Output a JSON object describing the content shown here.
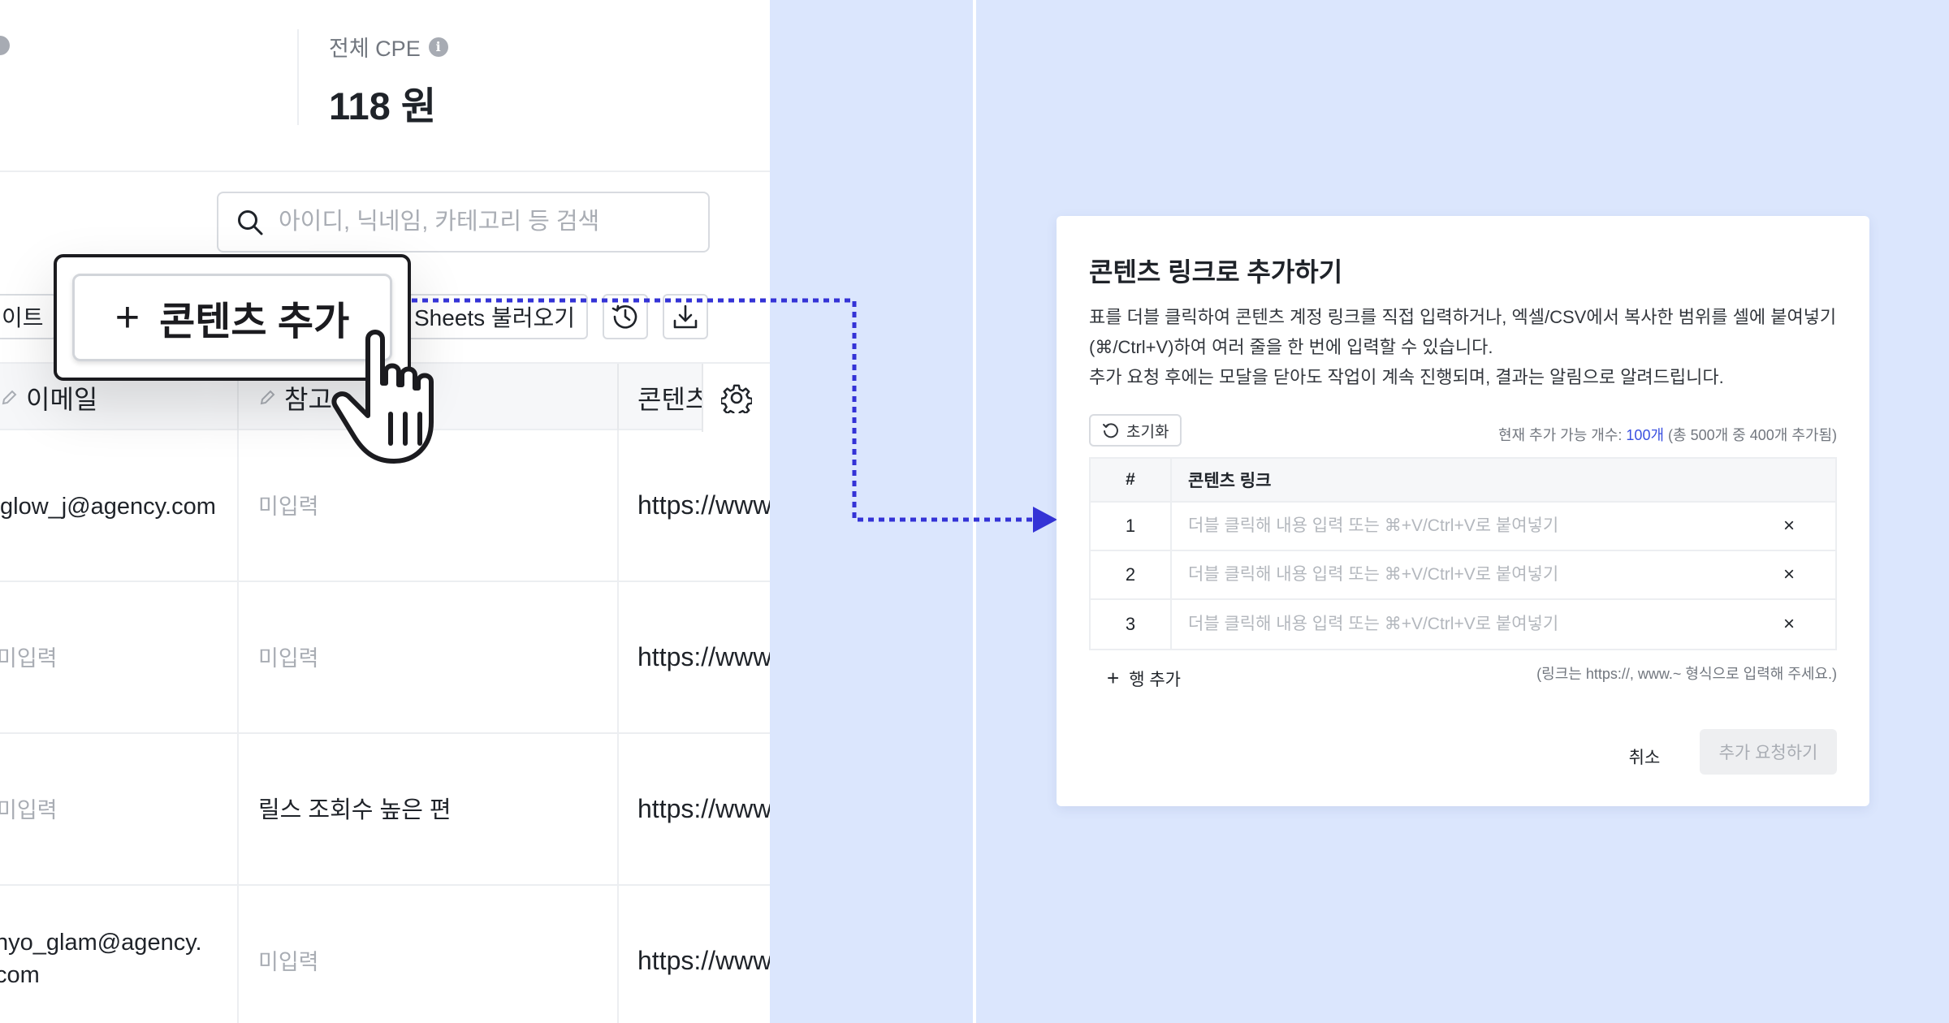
{
  "stats": {
    "total_cpe_label": "전체 CPE",
    "total_cpe_value": "118 원"
  },
  "search": {
    "placeholder": "아이디, 닉네임, 카테고리 등 검색",
    "value": ""
  },
  "toolbar": {
    "partial_button_label": "이트",
    "sheets_button_label": "Sheets 불러오기",
    "history_icon": "history-icon",
    "download_icon": "download-icon"
  },
  "callout": {
    "add_content_label": "콘텐츠 추가",
    "icon": "plus-icon",
    "cursor_icon": "hand-pointer-icon"
  },
  "table": {
    "columns": [
      "이메일",
      "참고",
      "콘텐츠"
    ],
    "settings_icon": "gear-icon",
    "rows": [
      {
        "email": "glow_j@agency.com",
        "note": "미입력",
        "link": "https://www"
      },
      {
        "email": "미입력",
        "note": "미입력",
        "link": "https://www"
      },
      {
        "email": "미입력",
        "note": "릴스 조회수 높은 편",
        "link": "https://www"
      },
      {
        "email": "nyo_glam@agency.\ncom",
        "note": "미입력",
        "link": "https://www"
      }
    ]
  },
  "colors": {
    "accent": "#3a50e0",
    "connector": "#3433d6",
    "background_right": "#dbe6fd"
  },
  "modal": {
    "title": "콘텐츠 링크로 추가하기",
    "description_line1": "표를 더블 클릭하여 콘텐츠 계정 링크를 직접 입력하거나, 엑셀/CSV에서 복사한 범위를 셀에 붙여넣기",
    "description_line2": "(⌘/Ctrl+V)하여 여러 줄을 한 번에 입력할 수 있습니다.",
    "description_line3": "추가 요청 후에는 모달을 닫아도 작업이 계속 진행되며, 결과는 알림으로 알려드립니다.",
    "reset_label": "초기화",
    "capacity_prefix": "현재 추가 가능 개수: ",
    "capacity_highlight": "100개",
    "capacity_suffix": " (총 500개 중 400개 추가됨)",
    "table_header_num": "#",
    "table_header_link": "콘텐츠 링크",
    "rows": [
      {
        "num": "1",
        "placeholder": "더블 클릭해 내용 입력 또는 ⌘+V/Ctrl+V로 붙여넣기"
      },
      {
        "num": "2",
        "placeholder": "더블 클릭해 내용 입력 또는 ⌘+V/Ctrl+V로 붙여넣기"
      },
      {
        "num": "3",
        "placeholder": "더블 클릭해 내용 입력 또는 ⌘+V/Ctrl+V로 붙여넣기"
      }
    ],
    "close_glyph": "×",
    "add_row_label": "행 추가",
    "hint": "(링크는 https://, www.~ 형식으로 입력해 주세요.)",
    "cancel_label": "취소",
    "submit_label": "추가 요청하기"
  }
}
